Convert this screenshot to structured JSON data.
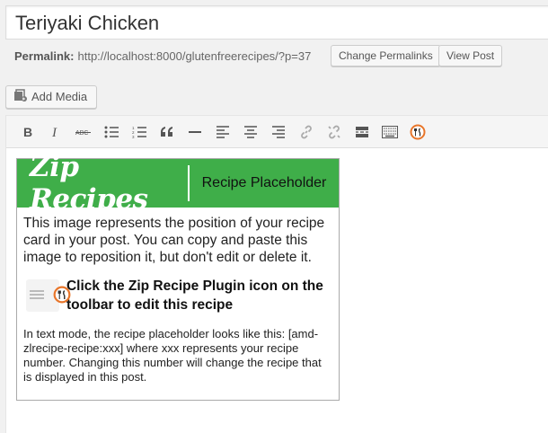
{
  "post_title": "Teriyaki Chicken",
  "permalink": {
    "label": "Permalink:",
    "url": "http://localhost:8000/glutenfreerecipes/?p=37",
    "change_button": "Change Permalinks",
    "view_button": "View Post"
  },
  "add_media_label": "Add Media",
  "toolbar_icons": [
    "bold-icon",
    "italic-icon",
    "strikethrough-icon",
    "bullet-list-icon",
    "numbered-list-icon",
    "blockquote-icon",
    "horizontal-line-icon",
    "align-left-icon",
    "align-center-icon",
    "align-right-icon",
    "link-icon",
    "unlink-icon",
    "read-more-icon",
    "toolbar-toggle-icon",
    "zip-recipes-icon"
  ],
  "placeholder_card": {
    "logo_text": "Zip Recipes",
    "header_label": "Recipe Placeholder",
    "paragraph1": "This image represents the position of your recipe card in your post. You can copy and paste this image to reposition it, but don't edit or delete it.",
    "instruction": "Click the Zip Recipe Plugin icon on the toolbar to edit this recipe",
    "paragraph2": "In text mode, the recipe placeholder looks like this: [amd-zlrecipe-recipe:xxx] where xxx represents your recipe number. Changing this number will change the recipe that is displayed in this post."
  },
  "colors": {
    "brand_green": "#3fae49",
    "zip_icon_orange": "#e8762b"
  }
}
